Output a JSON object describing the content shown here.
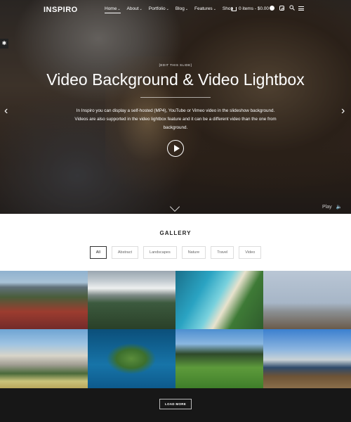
{
  "header": {
    "logo": "INSPIRO",
    "menu": [
      {
        "label": "Home",
        "has_dropdown": true,
        "active": true
      },
      {
        "label": "About",
        "has_dropdown": true
      },
      {
        "label": "Portfolio",
        "has_dropdown": true
      },
      {
        "label": "Blog",
        "has_dropdown": true
      },
      {
        "label": "Features",
        "has_dropdown": true
      },
      {
        "label": "Shop",
        "has_dropdown": false
      }
    ],
    "cart_label": "0 items - $0.00",
    "caret": "⌄",
    "icons": [
      "facebook-icon",
      "instagram-icon",
      "search-icon",
      "menu-icon"
    ]
  },
  "hero": {
    "edit_label": "[EDIT THIS SLIDE]",
    "title": "Video Background & Video Lightbox",
    "description": "In Inspiro you can display a self-hosted (MP4), YouTube or Vimeo video in the slideshow background. Videos are also supported in the video lightbox feature and it can be a different video than the one from background.",
    "play_label": "Play",
    "prev_arrow": "‹",
    "next_arrow": "›",
    "settings_icon": "✱",
    "mute_icon": "🔈"
  },
  "gallery": {
    "title": "GALLERY",
    "filters": [
      {
        "label": "All",
        "active": true
      },
      {
        "label": "Abstract"
      },
      {
        "label": "Landscapes"
      },
      {
        "label": "Nature"
      },
      {
        "label": "Travel"
      },
      {
        "label": "Video"
      }
    ],
    "load_more": "LOAD MORE"
  }
}
